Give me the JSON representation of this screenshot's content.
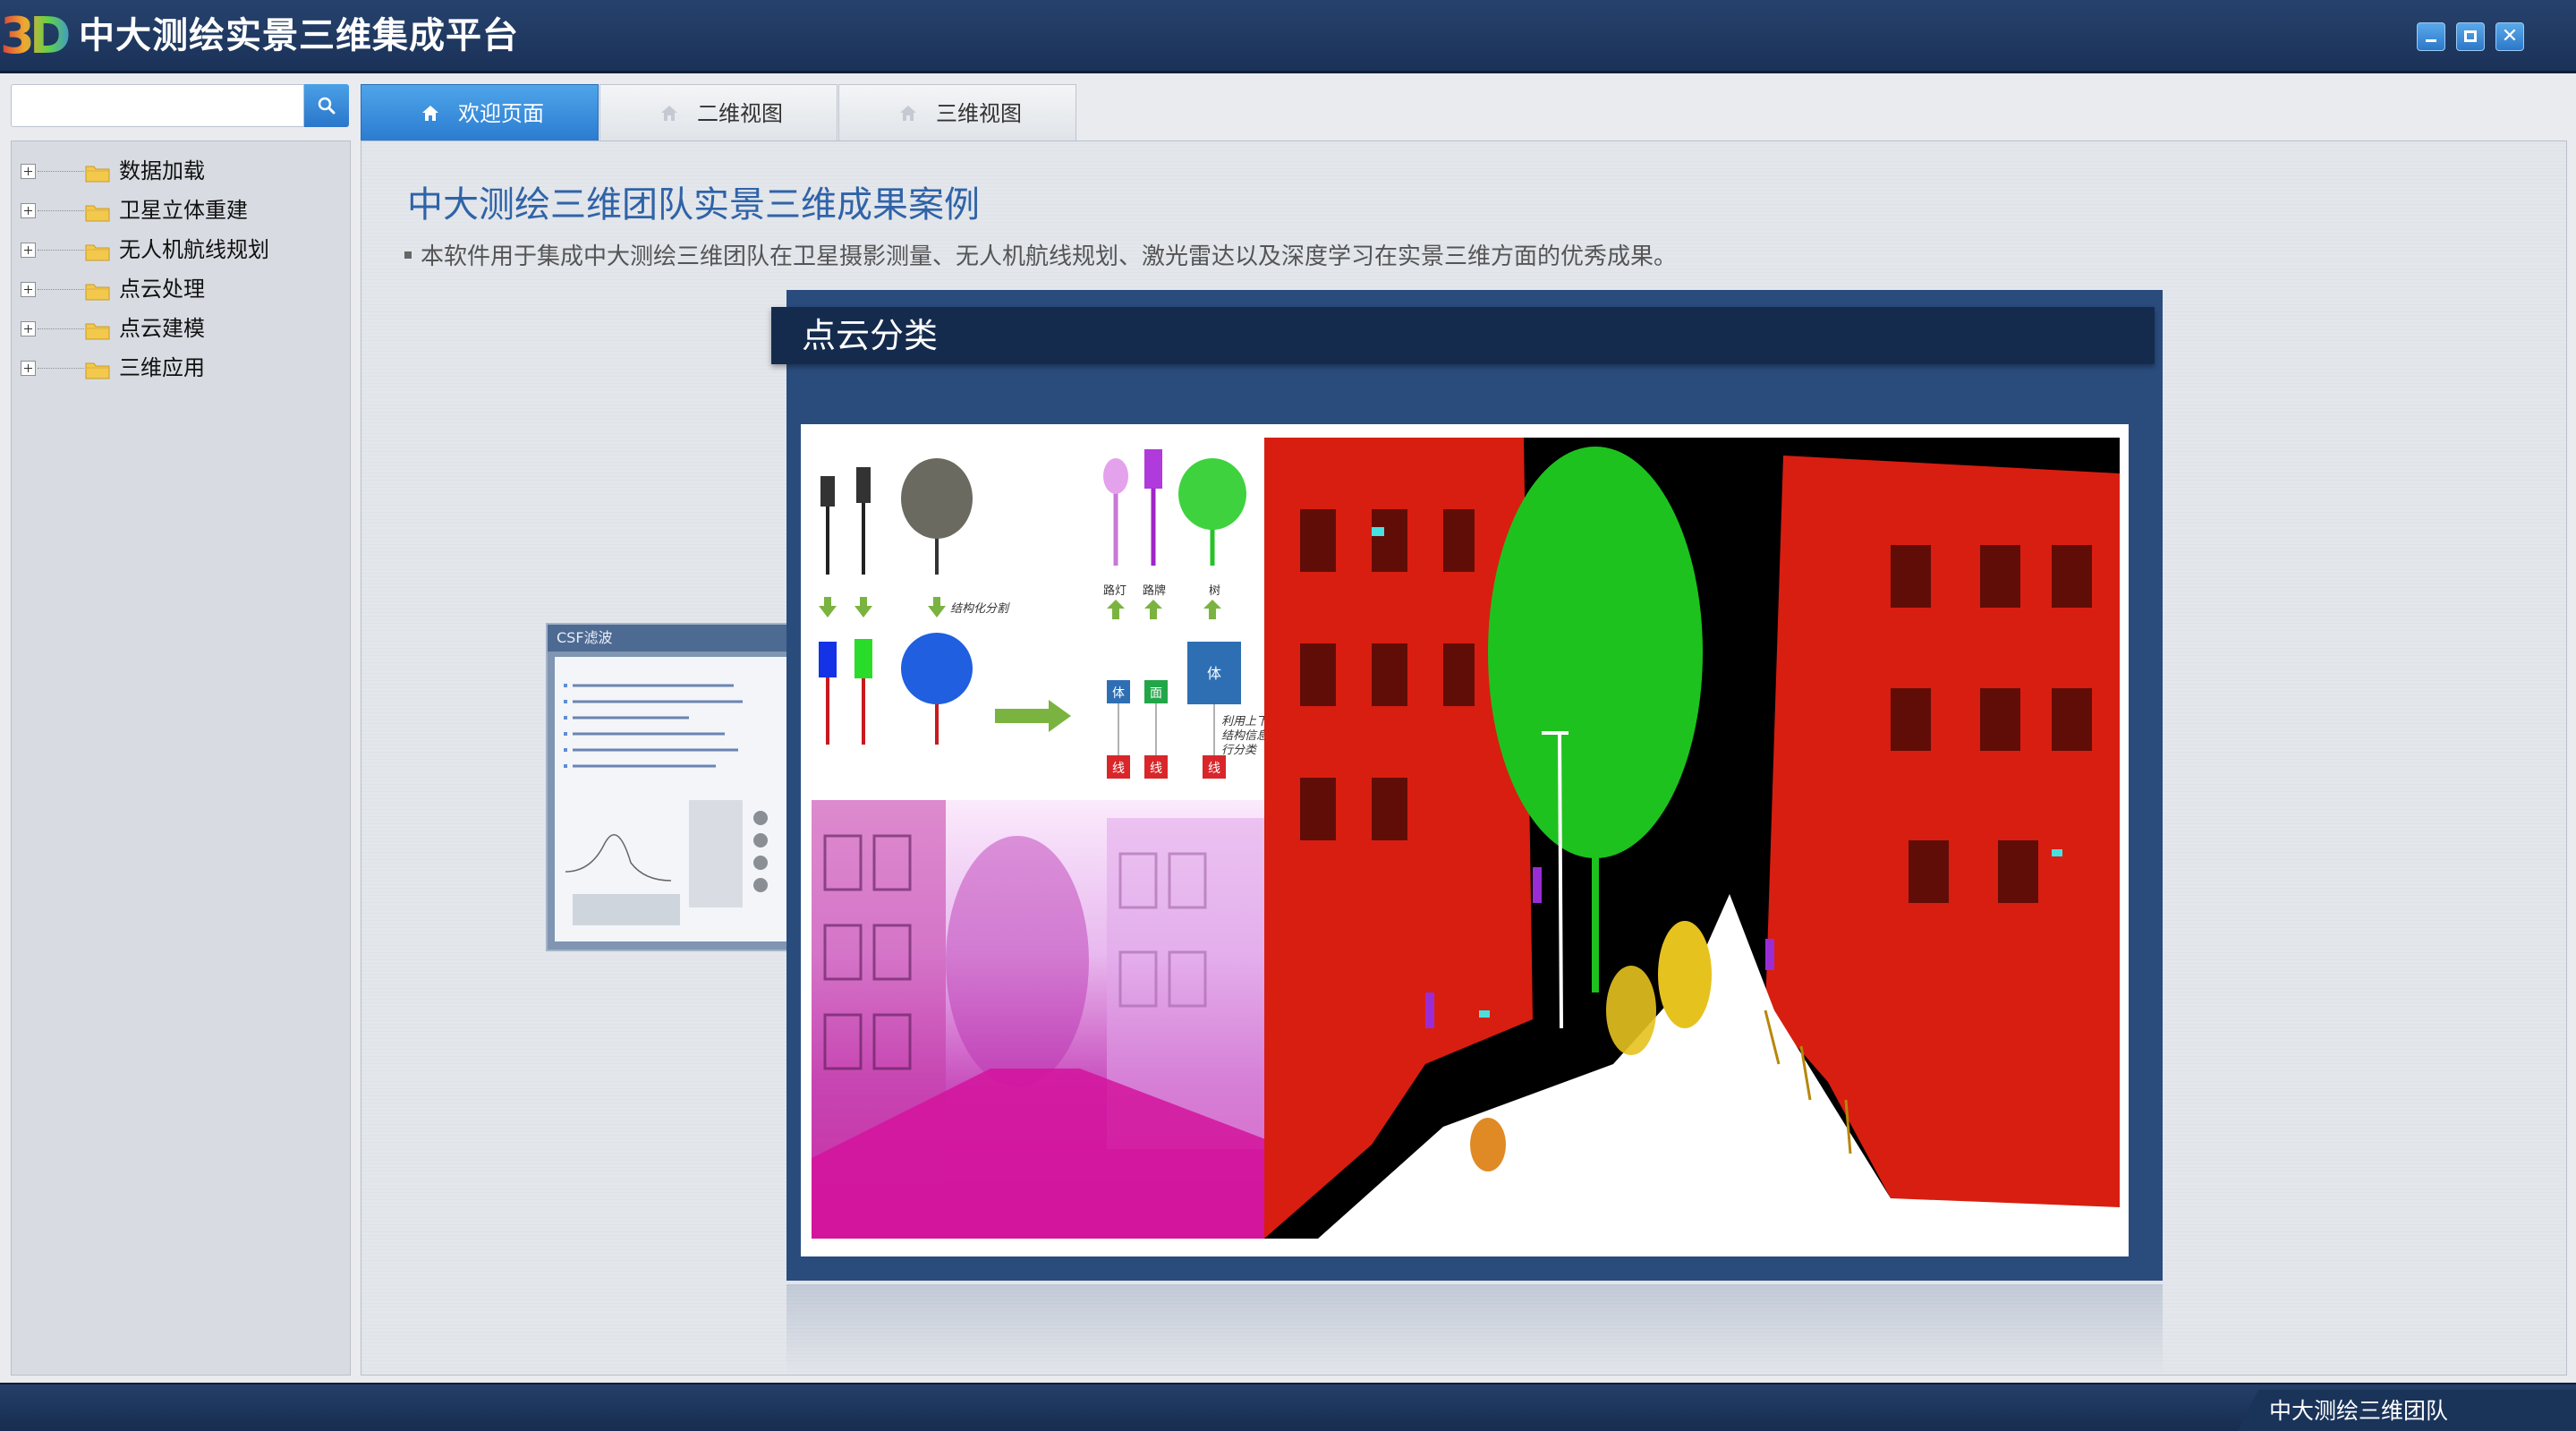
{
  "app": {
    "logo_text": "3D",
    "title": "中大测绘实景三维集成平台",
    "window_buttons": [
      "minimize-icon",
      "maximize-icon",
      "close-icon"
    ]
  },
  "search": {
    "value": "",
    "placeholder": ""
  },
  "tree": {
    "items": [
      {
        "label": "数据加载"
      },
      {
        "label": "卫星立体重建"
      },
      {
        "label": "无人机航线规划"
      },
      {
        "label": "点云处理"
      },
      {
        "label": "点云建模"
      },
      {
        "label": "三维应用"
      }
    ]
  },
  "tabs": [
    {
      "label": "欢迎页面",
      "active": true
    },
    {
      "label": "二维视图",
      "active": false
    },
    {
      "label": "三维视图",
      "active": false
    }
  ],
  "welcome": {
    "title": "中大测绘三维团队实景三维成果案例",
    "description": "本软件用于集成中大测绘三维团队在卫星摄影测量、无人机航线规划、激光雷达以及深度学习在实景三维方面的优秀成果。"
  },
  "carousel": {
    "back_slide_title": "CSF滤波",
    "current_slide_title": "点云分类",
    "diagram": {
      "step_label": "结构化分割",
      "top_labels": [
        "路灯",
        "路牌",
        "树"
      ],
      "body_label": "体",
      "face_label": "面",
      "line_label": "线",
      "note": [
        "利用上下文",
        "结构信息进",
        "行分类"
      ]
    }
  },
  "footer": {
    "team": "中大测绘三维团队"
  },
  "colors": {
    "titlebar": "#1f3a63",
    "accent": "#2b7bd0",
    "slide_bg": "#2a4c7d",
    "banner_bg": "#152b4d",
    "class_building": "#d81e10",
    "class_tree": "#1ec21e",
    "class_ground": "#ffffff"
  }
}
